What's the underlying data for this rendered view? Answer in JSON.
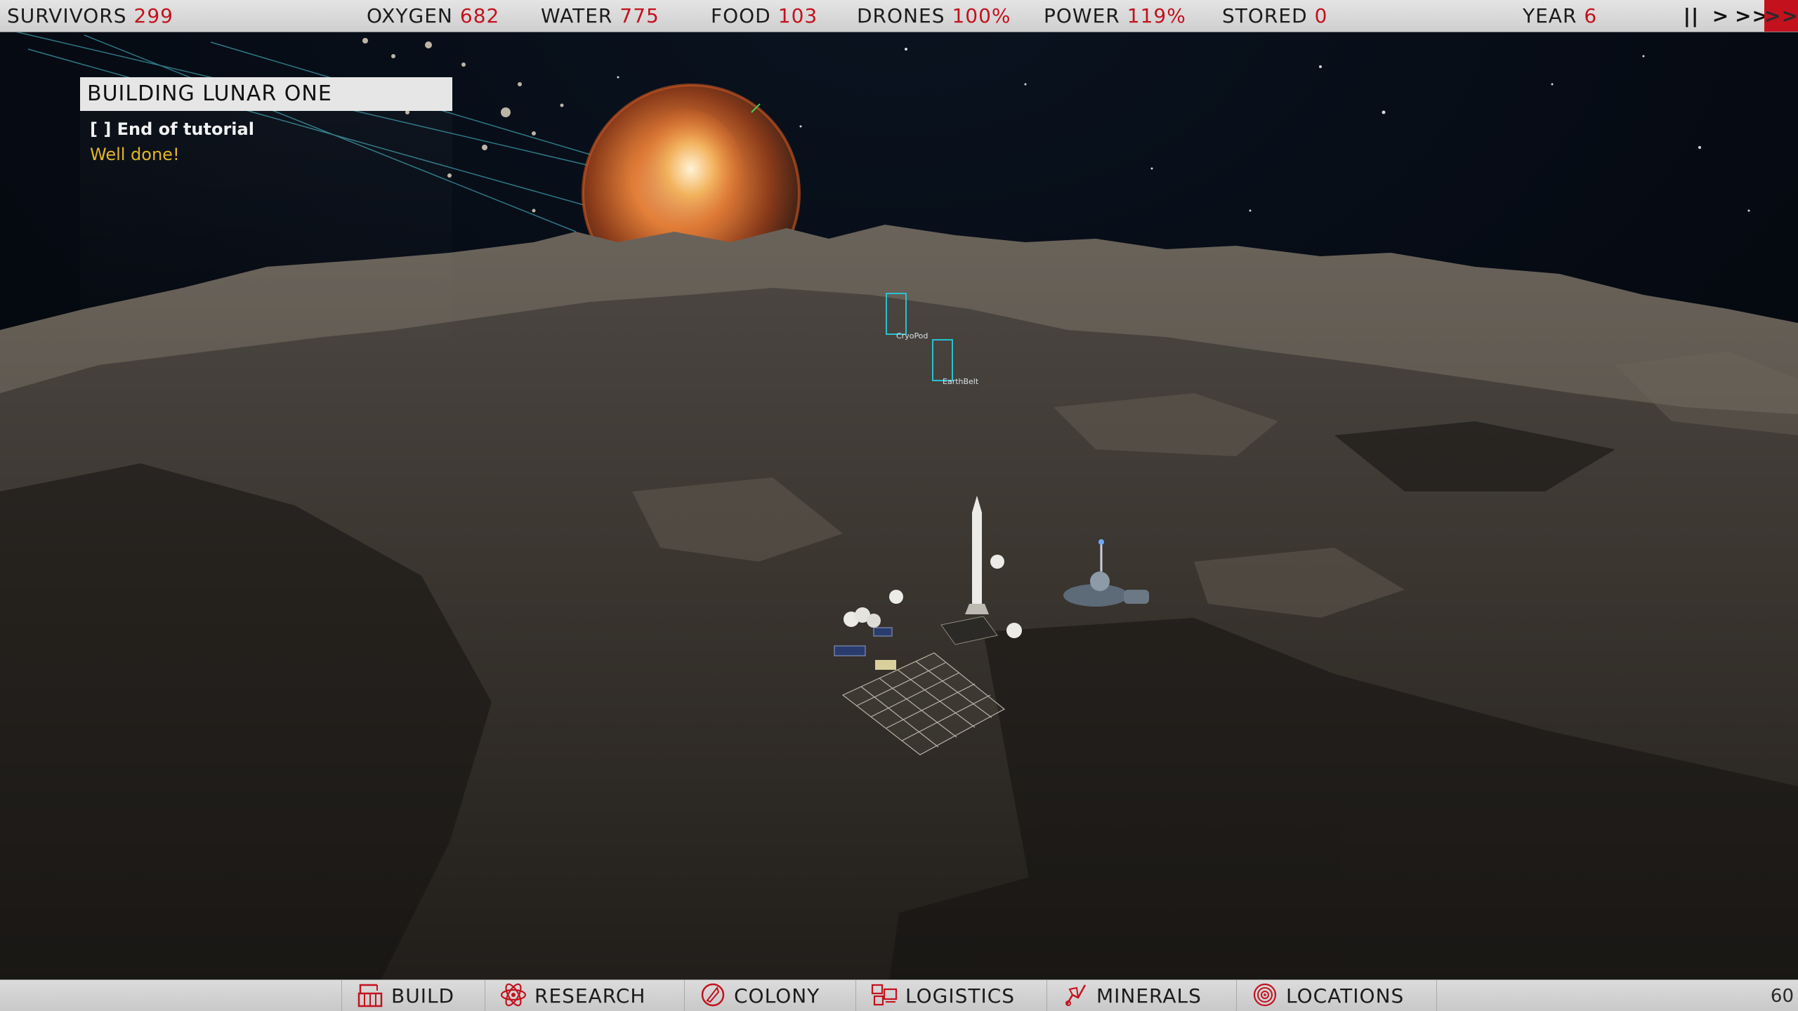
{
  "topbar": {
    "stats": [
      {
        "label": "SURVIVORS",
        "value": "299"
      },
      {
        "label": "OXYGEN",
        "value": "682"
      },
      {
        "label": "WATER",
        "value": "775"
      },
      {
        "label": "FOOD",
        "value": "103"
      },
      {
        "label": "DRONES",
        "value": "100%"
      },
      {
        "label": "POWER",
        "value": "119%"
      },
      {
        "label": "STORED",
        "value": "0"
      },
      {
        "label": "YEAR",
        "value": "6"
      }
    ],
    "controls": {
      "pause": "||",
      "play": ">",
      "fast": ">>",
      "fastest": ">>>"
    },
    "accent_color": "#c3121e"
  },
  "objective": {
    "title": "BUILDING LUNAR ONE",
    "task": "[  ] End of tutorial",
    "status": "Well done!"
  },
  "markers": [
    {
      "label": "CryoPod"
    },
    {
      "label": "EarthBelt"
    }
  ],
  "bottombar": {
    "items": [
      {
        "label": "BUILD",
        "icon": "build-icon"
      },
      {
        "label": "RESEARCH",
        "icon": "research-icon"
      },
      {
        "label": "COLONY",
        "icon": "colony-icon"
      },
      {
        "label": "LOGISTICS",
        "icon": "logistics-icon"
      },
      {
        "label": "MINERALS",
        "icon": "minerals-icon"
      },
      {
        "label": "LOCATIONS",
        "icon": "locations-icon"
      }
    ],
    "fps": "60"
  }
}
